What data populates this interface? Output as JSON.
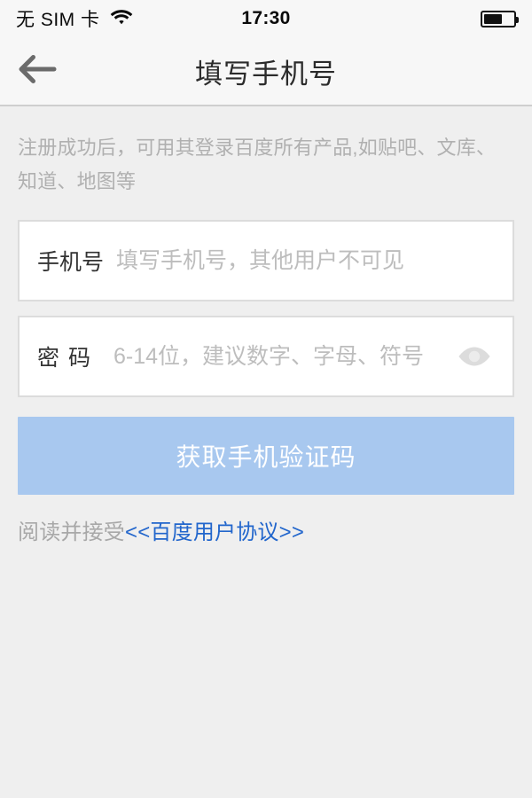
{
  "status_bar": {
    "carrier": "无 SIM 卡",
    "wifi_icon": "wifi-icon",
    "time": "17:30",
    "battery_icon": "battery-icon",
    "battery_level_percent": 62
  },
  "nav_bar": {
    "back_icon": "back-arrow-icon",
    "title": "填写手机号"
  },
  "content": {
    "intro_text": "注册成功后，可用其登录百度所有产品,如贴吧、文库、知道、地图等",
    "phone_field": {
      "label": "手机号",
      "value": "",
      "placeholder": "填写手机号，其他用户不可见"
    },
    "password_field": {
      "label": "密码",
      "value": "",
      "placeholder": "6-14位，建议数字、字母、符号",
      "toggle_icon": "eye-icon"
    },
    "submit_button": {
      "label": "获取手机验证码"
    },
    "agreement": {
      "prefix": "阅读并接受",
      "link_text": "<<百度用户协议>>"
    }
  },
  "colors": {
    "page_background": "#efefef",
    "bar_background": "#f7f7f7",
    "button_blue": "#a8c8ef",
    "link_blue": "#2266cc",
    "label_dark": "#333333",
    "placeholder_gray": "#bdbdbd",
    "intro_gray": "#b0b0b0"
  }
}
